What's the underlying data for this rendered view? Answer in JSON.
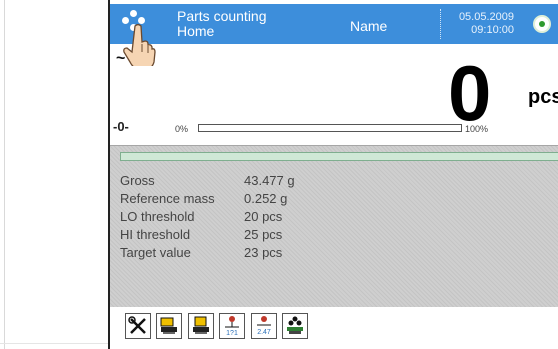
{
  "header": {
    "mode_title": "Parts counting",
    "profile": "Home",
    "user_name": "Name",
    "date": "05.05.2009",
    "time": "09:10:00"
  },
  "readout": {
    "stability": "~",
    "value": "0",
    "unit": "pcs",
    "zero_indicator": "-0-",
    "progress_min_label": "0%",
    "progress_max_label": "100%",
    "progress_fraction": 0
  },
  "info": {
    "rows": [
      {
        "label": "Gross",
        "value": "43.477 g"
      },
      {
        "label": "Reference mass",
        "value": "0.252 g"
      },
      {
        "label": "LO threshold",
        "value": "20 pcs"
      },
      {
        "label": "HI threshold",
        "value": "25 pcs"
      },
      {
        "label": "Target value",
        "value": "23 pcs"
      }
    ]
  },
  "toolbar": {
    "buttons": [
      {
        "icon": "tools-icon"
      },
      {
        "icon": "tare-icon"
      },
      {
        "icon": "tare-set-icon"
      },
      {
        "icon": "balance-compare-icon",
        "text": "1?1"
      },
      {
        "icon": "reference-mass-icon",
        "text": "2.47"
      },
      {
        "icon": "sample-weighing-icon"
      }
    ]
  },
  "colors": {
    "header_bg": "#3d8edb",
    "status_green": "#2e9a2e",
    "panel_bg": "#cfcfcf"
  }
}
